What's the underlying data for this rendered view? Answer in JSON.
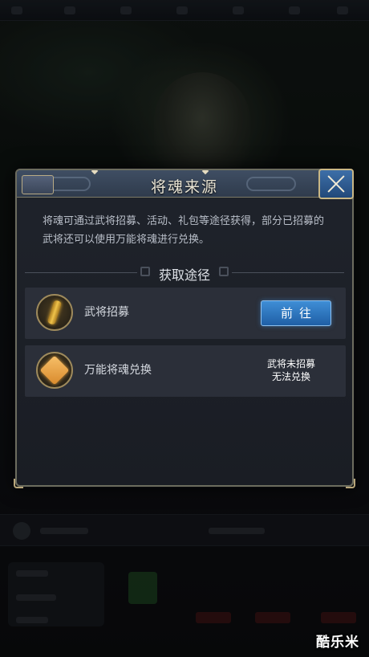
{
  "dialog": {
    "title": "将魂来源",
    "description": "将魂可通过武将招募、活动、礼包等途径获得，部分已招募的武将还可以使用万能将魂进行兑换。",
    "section_title": "获取途径",
    "sources": [
      {
        "label": "武将招募",
        "icon": "recruit-scroll-icon",
        "action_label": "前往"
      },
      {
        "label": "万能将魂兑换",
        "icon": "universal-soul-icon",
        "status_line1": "武将未招募",
        "status_line2": "无法兑换"
      }
    ]
  },
  "watermark": "酷乐米",
  "colors": {
    "accent_blue": "#2f74c0",
    "title_bar": "#3a4658",
    "frame_gold": "#b8a67a",
    "row_bg": "#2b2f39"
  }
}
